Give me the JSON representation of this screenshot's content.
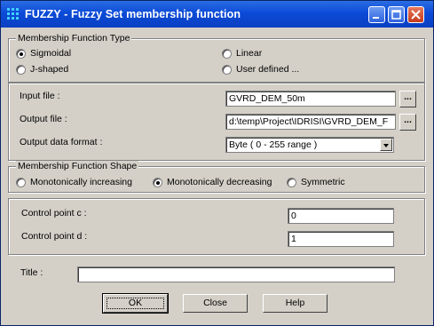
{
  "window": {
    "title": "FUZZY - Fuzzy Set membership function"
  },
  "type_group": {
    "label": "Membership Function Type",
    "options": [
      "Sigmoidal",
      "Linear",
      "J-shaped",
      "User defined ..."
    ],
    "selected": "Sigmoidal"
  },
  "files": {
    "input_label": "Input file :",
    "input_value": "GVRD_DEM_50m",
    "output_label": "Output file :",
    "output_value": "d:\\temp\\Project\\IDRISI\\GVRD_DEM_F",
    "format_label": "Output data format :",
    "format_value": "Byte  ( 0 - 255 range )",
    "browse_label": "..."
  },
  "shape_group": {
    "label": "Membership Function Shape",
    "options": [
      "Monotonically increasing",
      "Monotonically decreasing",
      "Symmetric"
    ],
    "selected": "Monotonically decreasing"
  },
  "control_points": {
    "c_label": "Control point c :",
    "c_value": "0",
    "d_label": "Control point d :",
    "d_value": "1"
  },
  "title_field": {
    "label": "Title :",
    "value": ""
  },
  "buttons": {
    "ok": "OK",
    "close": "Close",
    "help": "Help"
  }
}
